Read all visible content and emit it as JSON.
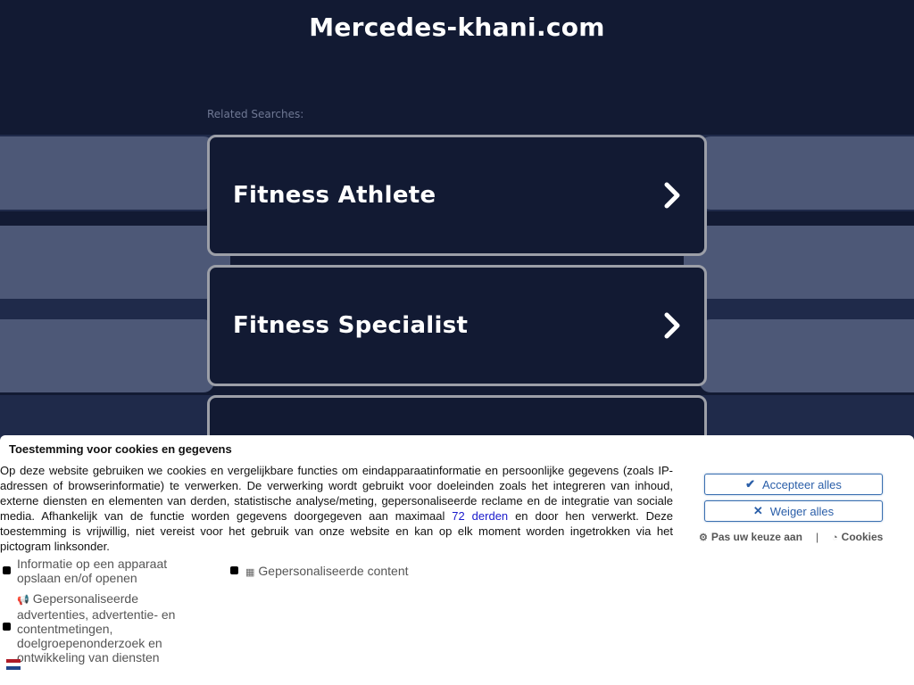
{
  "site": {
    "title": "Mercedes-khani.com"
  },
  "related": {
    "label": "Related Searches:",
    "items": [
      {
        "label": "Fitness Athlete"
      },
      {
        "label": "Fitness Specialist"
      },
      {
        "label": ""
      }
    ]
  },
  "consent": {
    "title": "Toestemming voor cookies en gegevens",
    "text_before": "Op deze website gebruiken we cookies en vergelijkbare functies om eindapparaatinformatie en persoonlijke gegevens (zoals IP-adressen of browserinformatie) te verwerken. De verwerking wordt gebruikt voor doeleinden zoals het integreren van inhoud, externe diensten en elementen van derden, statistische analyse/meting, gepersonaliseerde reclame en de integratie van sociale media. Afhankelijk van de functie worden gegevens doorgegeven aan maximaal ",
    "link_text": "72 derden",
    "text_after": " en door hen verwerkt. Deze toestemming is vrijwillig, niet vereist voor het gebruik van onze website en kan op elk moment worden ingetrokken via het pictogram linksonder.",
    "purposes": {
      "device": "Informatie op een apparaat opslaan en/of openen",
      "content": "Gepersonaliseerde content",
      "ads": "Gepersonaliseerde advertenties, advertentie- en contentmetingen, doelgroepenonderzoek en ontwikkeling van diensten"
    },
    "accept_label": "Accepteer alles",
    "reject_label": "Weiger alles",
    "customize_label": "Pas uw keuze aan",
    "separator": "|",
    "cookies_label": "Cookies"
  },
  "colors": {
    "background": "#121a33",
    "band": "#1f2a4a",
    "side_block": "#4d5877",
    "card_border": "#9c9fa8",
    "button_blue": "#2a5ea8"
  }
}
